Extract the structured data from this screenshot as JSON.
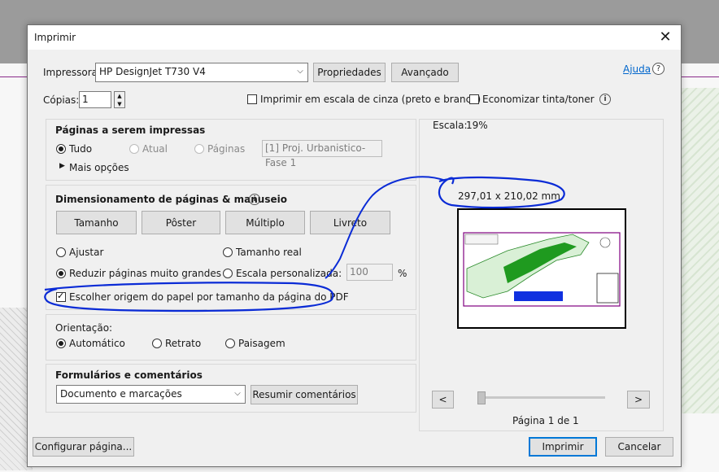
{
  "dialog": {
    "title": "Imprimir",
    "close_glyph": "✕"
  },
  "printer": {
    "label": "Impressora:",
    "value": "HP DesignJet T730 V4",
    "properties_button": "Propriedades",
    "advanced_button": "Avançado",
    "help_link": "Ajuda",
    "help_icon": "?"
  },
  "copies": {
    "label": "Cópias:",
    "value": "1",
    "grayscale_label": "Imprimir em escala de cinza (preto e branco)",
    "save_ink_label": "Economizar tinta/toner",
    "info_icon": "i"
  },
  "pages_to_print": {
    "heading": "Páginas a serem impressas",
    "all_label": "Tudo",
    "current_label": "Atual",
    "pages_label": "Páginas",
    "pages_value": "[1] Proj. Urbanistico-Fase 1",
    "more_options": "Mais opções"
  },
  "sizing": {
    "heading": "Dimensionamento de páginas & manuseio",
    "info_icon": "i",
    "tab_size": "Tamanho",
    "tab_poster": "Pôster",
    "tab_multiple": "Múltiplo",
    "tab_booklet": "Livreto",
    "fit_label": "Ajustar",
    "actual_size_label": "Tamanho real",
    "shrink_label": "Reduzir páginas muito grandes",
    "custom_scale_label": "Escala personalizada:",
    "custom_scale_value": "100",
    "percent": "%",
    "paper_source_label": "Escolher origem do papel por tamanho da página do PDF"
  },
  "orientation": {
    "heading": "Orientação:",
    "auto_label": "Automático",
    "portrait_label": "Retrato",
    "landscape_label": "Paisagem"
  },
  "forms": {
    "heading": "Formulários e comentários",
    "value": "Documento e marcações",
    "summarize_button": "Resumir comentários"
  },
  "preview": {
    "scale_label": "Escala:",
    "scale_value": "19%",
    "dimensions": "297,01 x 210,02 mm",
    "prev_glyph": "<",
    "next_glyph": ">",
    "page_indicator": "Página 1 de 1"
  },
  "footer": {
    "page_setup_button": "Configurar página...",
    "print_button": "Imprimir",
    "cancel_button": "Cancelar"
  },
  "colors": {
    "annotation_blue": "#0a2bd6",
    "primary_border": "#0078d7",
    "link": "#0066cc"
  }
}
